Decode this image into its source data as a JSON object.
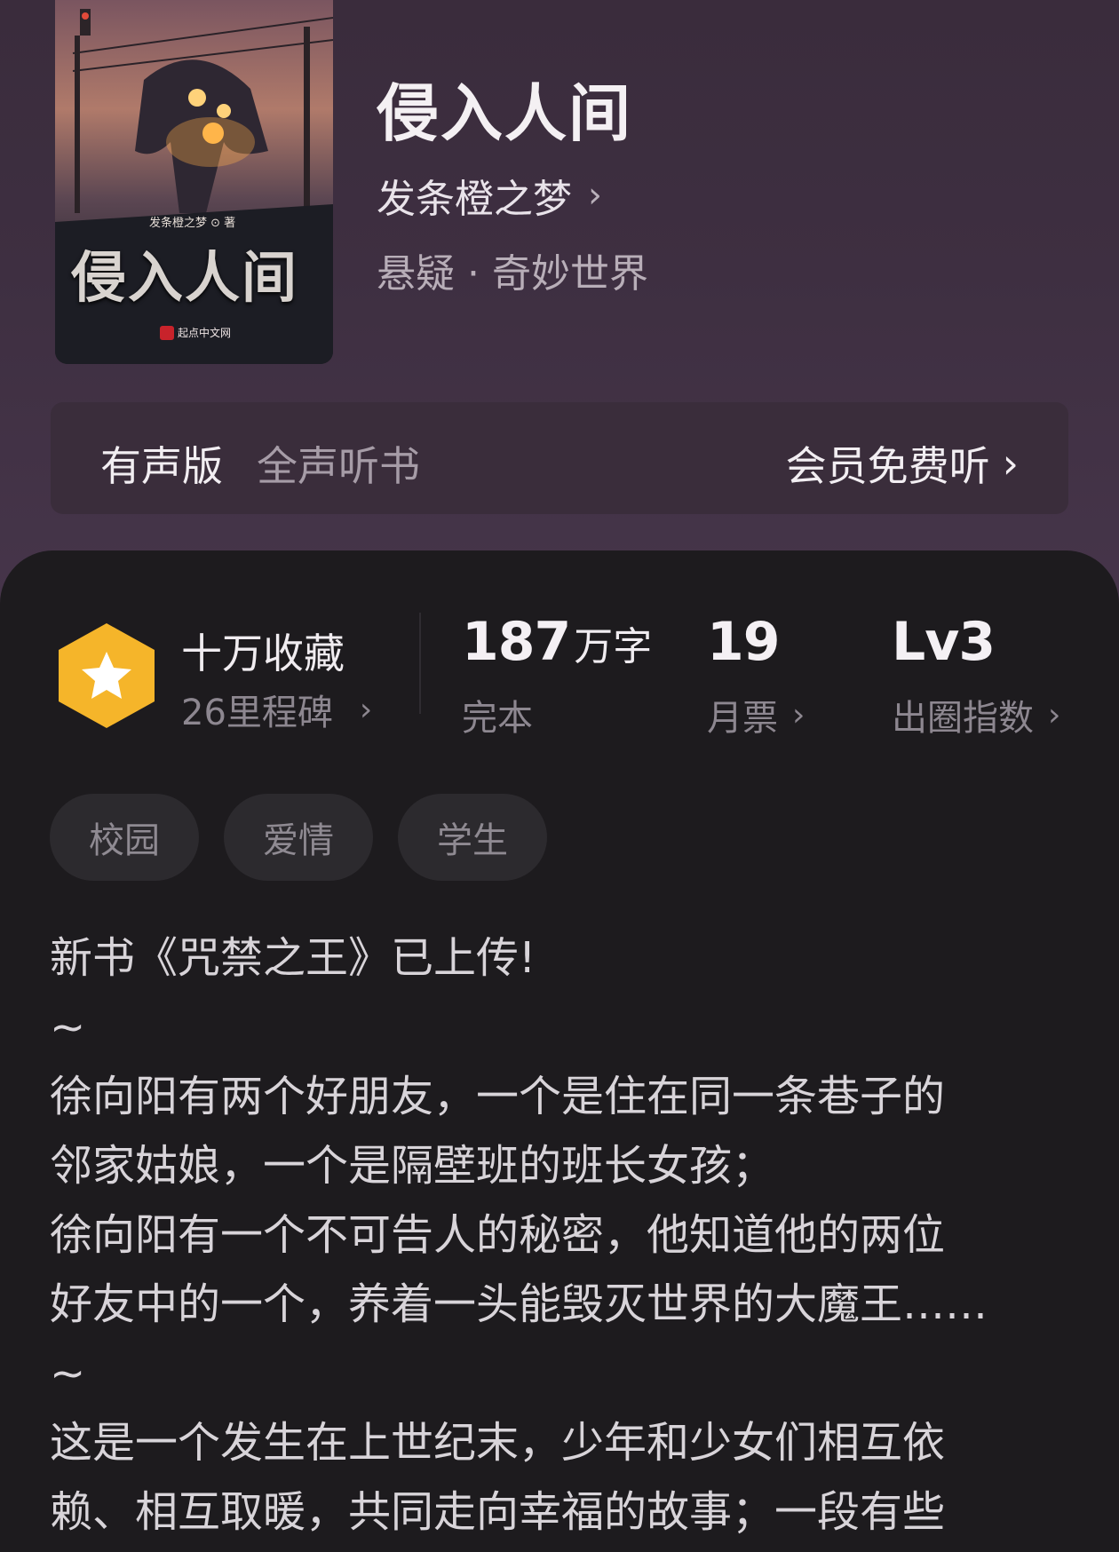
{
  "book": {
    "cover_author": "发条橙之梦 ⊙ 著",
    "cover_title": "侵入人间",
    "cover_publisher": "起点中文网",
    "title": "侵入人间",
    "author": "发条橙之梦",
    "genre": "悬疑 · 奇妙世界"
  },
  "audio": {
    "label": "有声版",
    "subtitle": "全声听书",
    "cta": "会员免费听"
  },
  "stats": {
    "collect_main": "十万收藏",
    "collect_sub": "26里程碑",
    "words_value": "187",
    "words_unit": "万字",
    "words_status": "完本",
    "monthly_value": "19",
    "monthly_label": "月票",
    "index_value": "Lv3",
    "index_label": "出圈指数"
  },
  "tags": [
    "校园",
    "爱情",
    "学生"
  ],
  "description": [
    "新书《咒禁之王》已上传!",
    "~",
    "徐向阳有两个好朋友，一个是住在同一条巷子的",
    "邻家姑娘，一个是隔壁班的班长女孩；",
    "徐向阳有一个不可告人的秘密，他知道他的两位",
    "好友中的一个，养着一头能毁灭世界的大魔王……",
    " ~",
    "这是一个发生在上世纪末，少年和少女们相互依",
    "赖、相互取暖，共同走向幸福的故事；一段有些"
  ],
  "colors": {
    "hero_bg": "#3e2f41",
    "sheet_bg": "#1d1b1e",
    "badge": "#f5b52a"
  }
}
